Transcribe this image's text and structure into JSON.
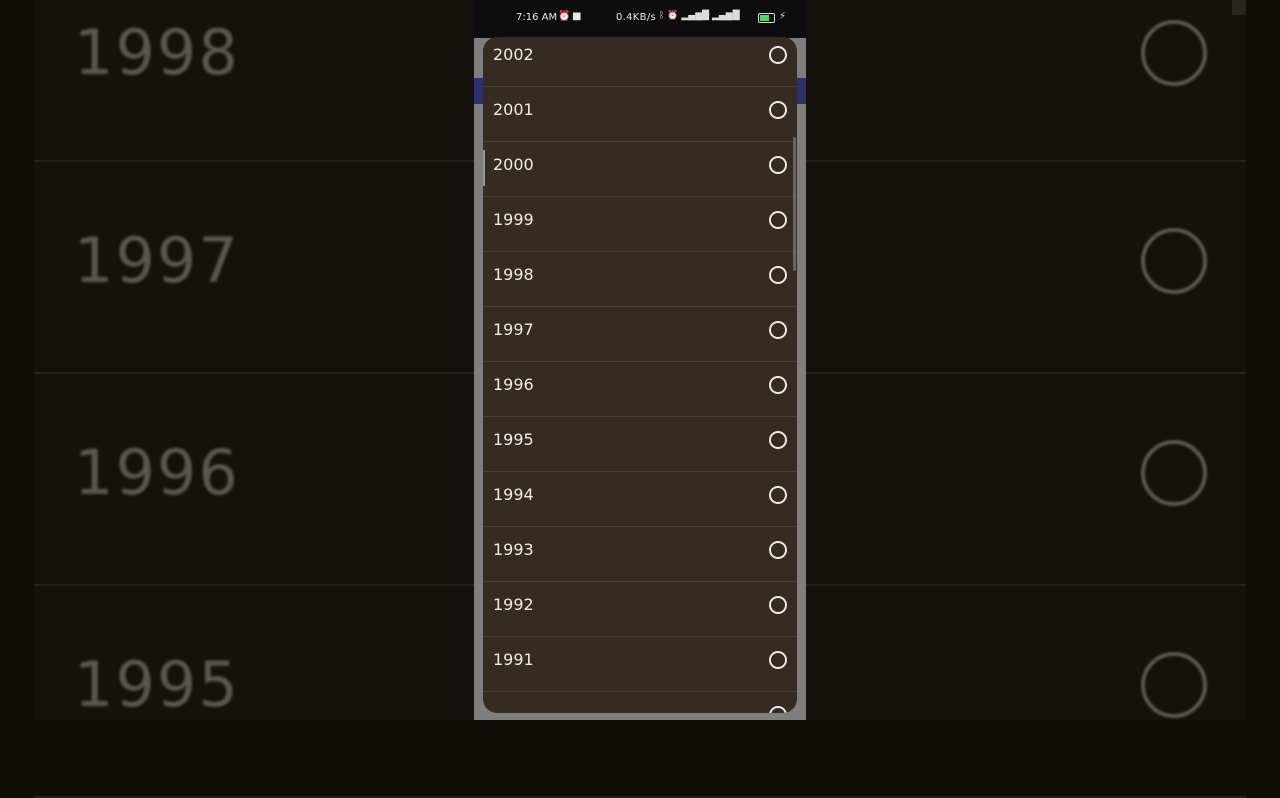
{
  "status_bar": {
    "time": "7:16 AM",
    "speed": "0.4KB/s",
    "icons": [
      "alarm-icon",
      "video-icon",
      "bluetooth-icon",
      "signal-icon",
      "battery-icon",
      "charging-icon"
    ]
  },
  "background": {
    "years": [
      "1998",
      "1997",
      "1996",
      "1995"
    ]
  },
  "dialog": {
    "years": [
      "2002",
      "2001",
      "2000",
      "1999",
      "1998",
      "1997",
      "1996",
      "1995",
      "1994",
      "1993",
      "1992",
      "1991"
    ]
  },
  "colors": {
    "dialog_bg": "#352b20",
    "accent_strip": "#2d2f6e"
  }
}
